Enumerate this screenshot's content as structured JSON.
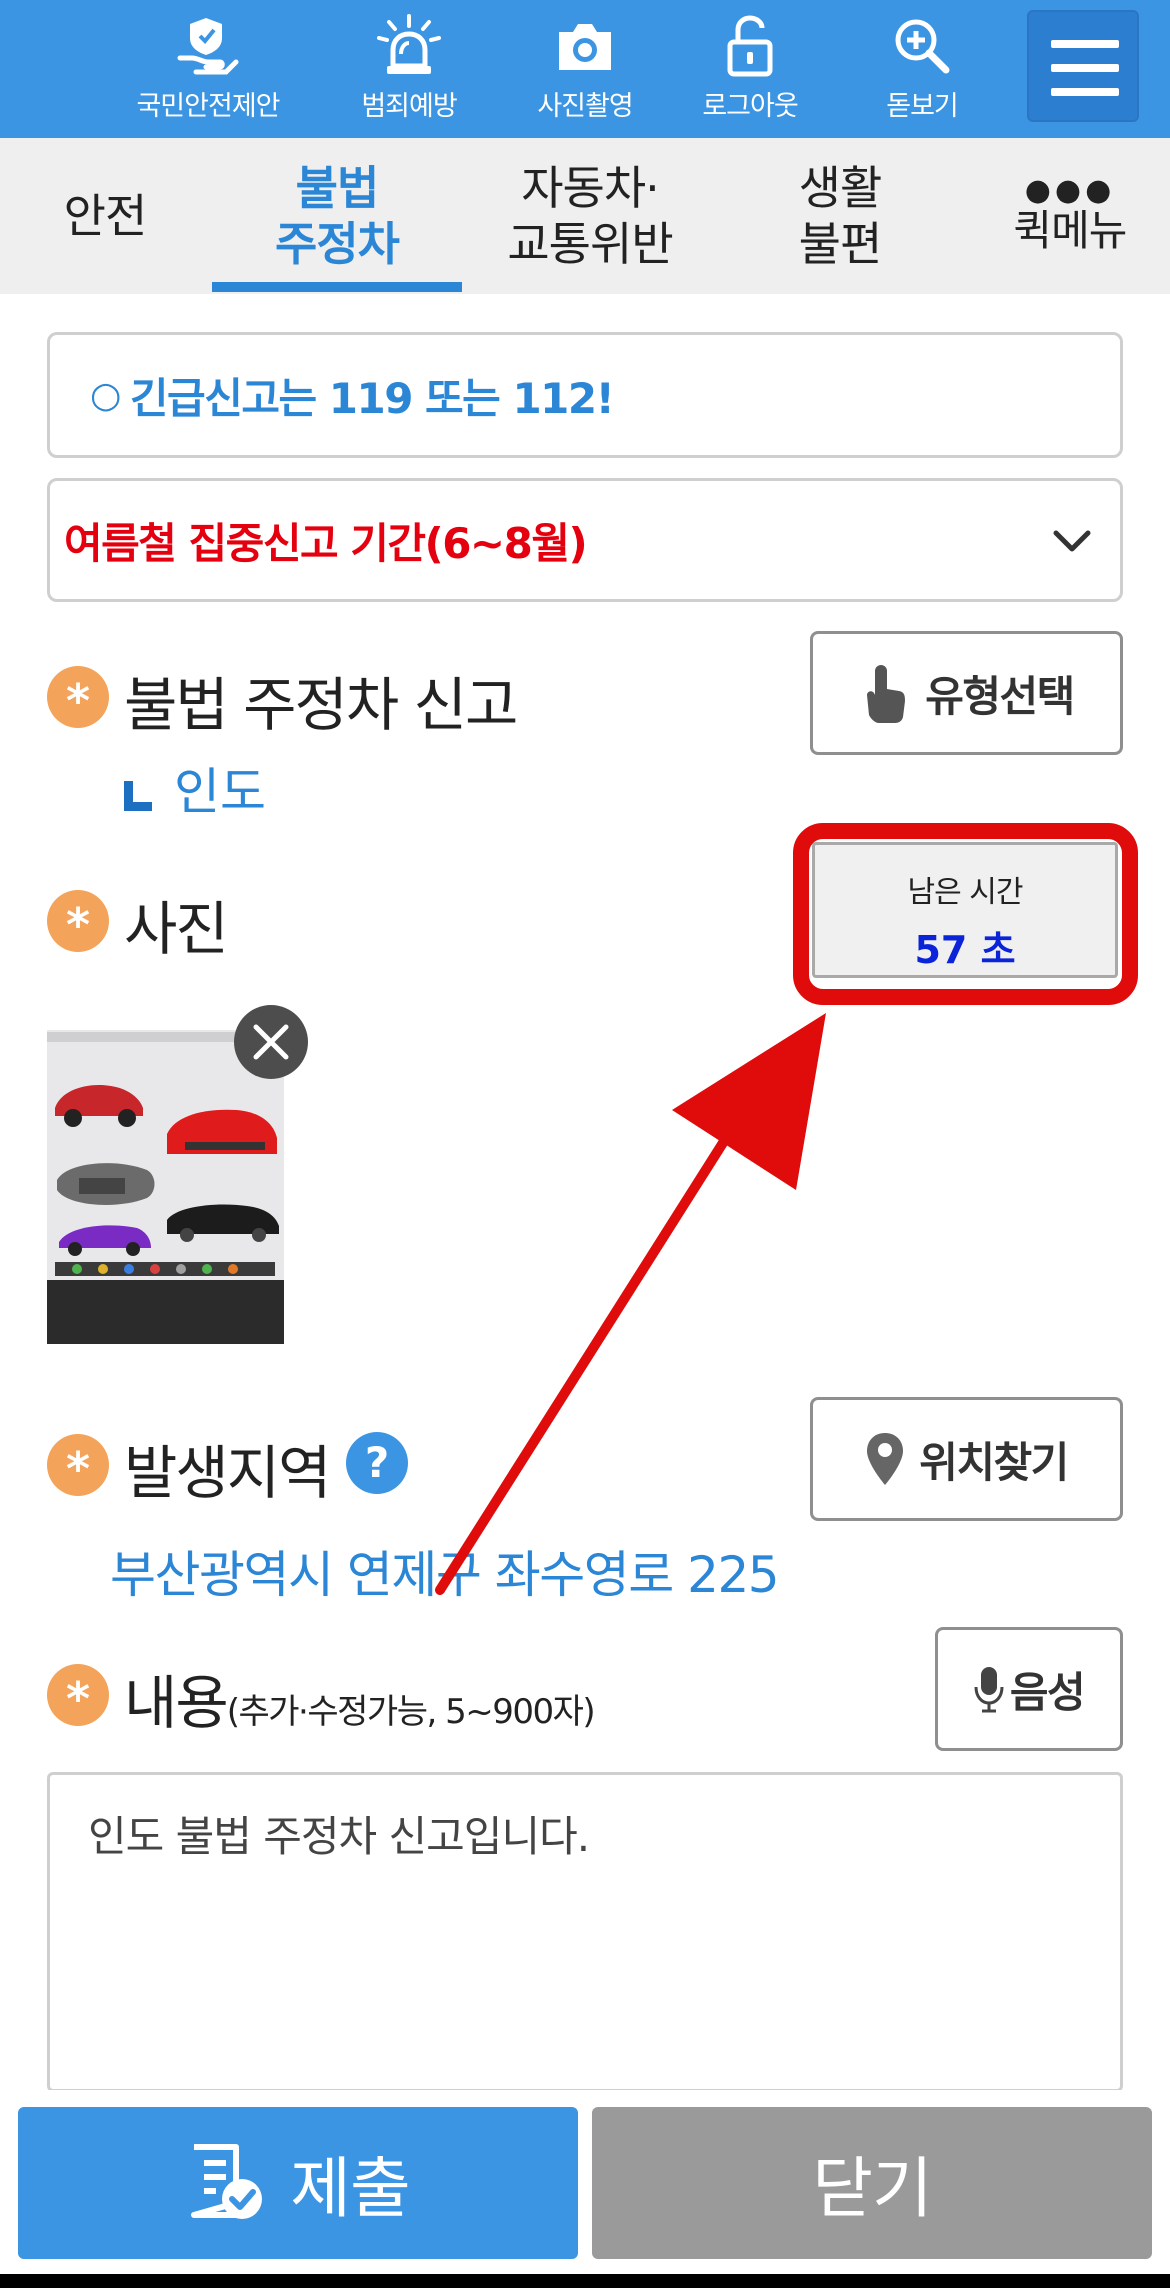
{
  "topbar": {
    "items": [
      {
        "label": "국민안전제안",
        "icon": "hand-shield-icon"
      },
      {
        "label": "범죄예방",
        "icon": "siren-icon"
      },
      {
        "label": "사진촬영",
        "icon": "camera-icon"
      },
      {
        "label": "로그아웃",
        "icon": "unlock-icon"
      },
      {
        "label": "돋보기",
        "icon": "zoom-in-icon"
      }
    ],
    "menu_icon": "hamburger-menu-icon"
  },
  "tabs": {
    "items": [
      {
        "line1": "안전",
        "line2": ""
      },
      {
        "line1": "불법",
        "line2": "주정차"
      },
      {
        "line1": "자동차·",
        "line2": "교통위반"
      },
      {
        "line1": "생활",
        "line2": "불편"
      }
    ],
    "active_index": 1,
    "quick_menu_dots": "●●●",
    "quick_menu_label": "퀵메뉴"
  },
  "notices": {
    "emergency_mark": "○",
    "emergency_text": "긴급신고는 119 또는 112!",
    "season_text": "여름철 집중신고 기간(6~8월)"
  },
  "report_type": {
    "asterisk": "*",
    "title": "불법 주정차 신고",
    "selected": "인도",
    "select_button": "유형선택"
  },
  "photo": {
    "asterisk": "*",
    "title": "사진",
    "timer_label": "남은 시간",
    "timer_value": "57 초"
  },
  "location": {
    "asterisk": "*",
    "title": "발생지역",
    "help_mark": "?",
    "find_button": "위치찾기",
    "address": "부산광역시 연제구 좌수영로 225"
  },
  "content": {
    "asterisk": "*",
    "title": "내용",
    "note": "(추가·수정가능, 5~900자)",
    "voice_button": "음성",
    "text": "인도 불법 주정차 신고입니다."
  },
  "actions": {
    "submit": "제출",
    "close": "닫기"
  },
  "colors": {
    "brand_blue": "#3c95e2",
    "active_tab": "#2b86d6",
    "alert_red": "#e4000f",
    "highlight_red": "#e00b0b",
    "timer_blue": "#0b23d9",
    "asterisk_orange": "#f4a35a"
  }
}
